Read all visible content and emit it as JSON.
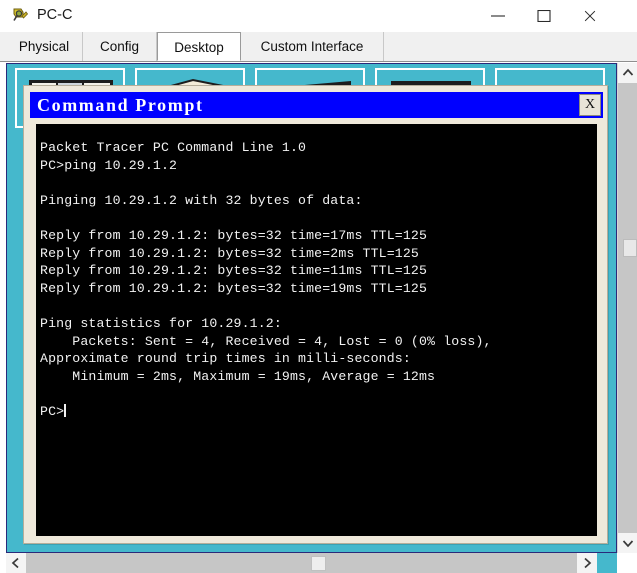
{
  "window": {
    "title": "PC-C",
    "icon": "packet-tracer-icon",
    "controls": {
      "minimize": "–",
      "maximize": "☐",
      "close": "✕"
    }
  },
  "tabs": [
    {
      "label": "Physical",
      "active": false
    },
    {
      "label": "Config",
      "active": false
    },
    {
      "label": "Desktop",
      "active": true
    },
    {
      "label": "Custom Interface",
      "active": false
    }
  ],
  "desktop": {
    "background_color": "#45b8cc",
    "icons": [
      {
        "name": "desktop-icon-1"
      },
      {
        "name": "desktop-icon-2"
      },
      {
        "name": "desktop-icon-3"
      },
      {
        "name": "desktop-icon-4"
      },
      {
        "name": "desktop-icon-5"
      }
    ]
  },
  "command_prompt": {
    "title": "Command Prompt",
    "title_bar_color": "#0000ff",
    "title_text_color": "#ffffff",
    "close_button_label": "X",
    "screen_background": "#000000",
    "screen_text_color": "#f2f2f2",
    "lines": [
      "Packet Tracer PC Command Line 1.0",
      "PC>ping 10.29.1.2",
      "",
      "Pinging 10.29.1.2 with 32 bytes of data:",
      "",
      "Reply from 10.29.1.2: bytes=32 time=17ms TTL=125",
      "Reply from 10.29.1.2: bytes=32 time=2ms TTL=125",
      "Reply from 10.29.1.2: bytes=32 time=11ms TTL=125",
      "Reply from 10.29.1.2: bytes=32 time=19ms TTL=125",
      "",
      "Ping statistics for 10.29.1.2:",
      "    Packets: Sent = 4, Received = 4, Lost = 0 (0% loss),",
      "Approximate round trip times in milli-seconds:",
      "    Minimum = 2ms, Maximum = 19ms, Average = 12ms",
      "",
      "PC>"
    ],
    "prompt": "PC>"
  },
  "scrollbars": {
    "vertical": {
      "up_arrow": "∧",
      "down_arrow": "∨"
    },
    "horizontal": {
      "left_arrow": "‹",
      "right_arrow": "›"
    }
  }
}
